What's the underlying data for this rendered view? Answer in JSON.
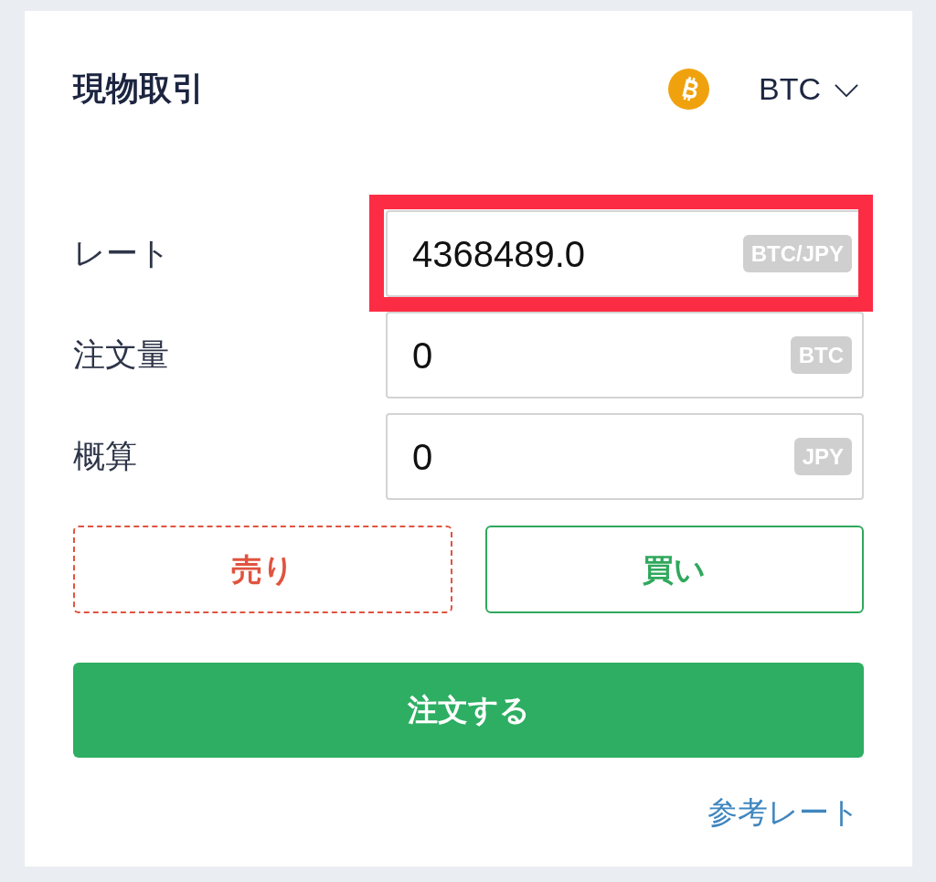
{
  "header": {
    "title": "現物取引",
    "currency": "BTC"
  },
  "fields": [
    {
      "label": "レート",
      "value": "4368489.0",
      "unit": "BTC/JPY",
      "highlighted": true
    },
    {
      "label": "注文量",
      "value": "0",
      "unit": "BTC",
      "highlighted": false
    },
    {
      "label": "概算",
      "value": "0",
      "unit": "JPY",
      "highlighted": false
    }
  ],
  "side_buttons": [
    {
      "label": "売り",
      "kind": "sell"
    },
    {
      "label": "買い",
      "kind": "buy"
    }
  ],
  "order_button": "注文する",
  "reference_link": "参考レート"
}
